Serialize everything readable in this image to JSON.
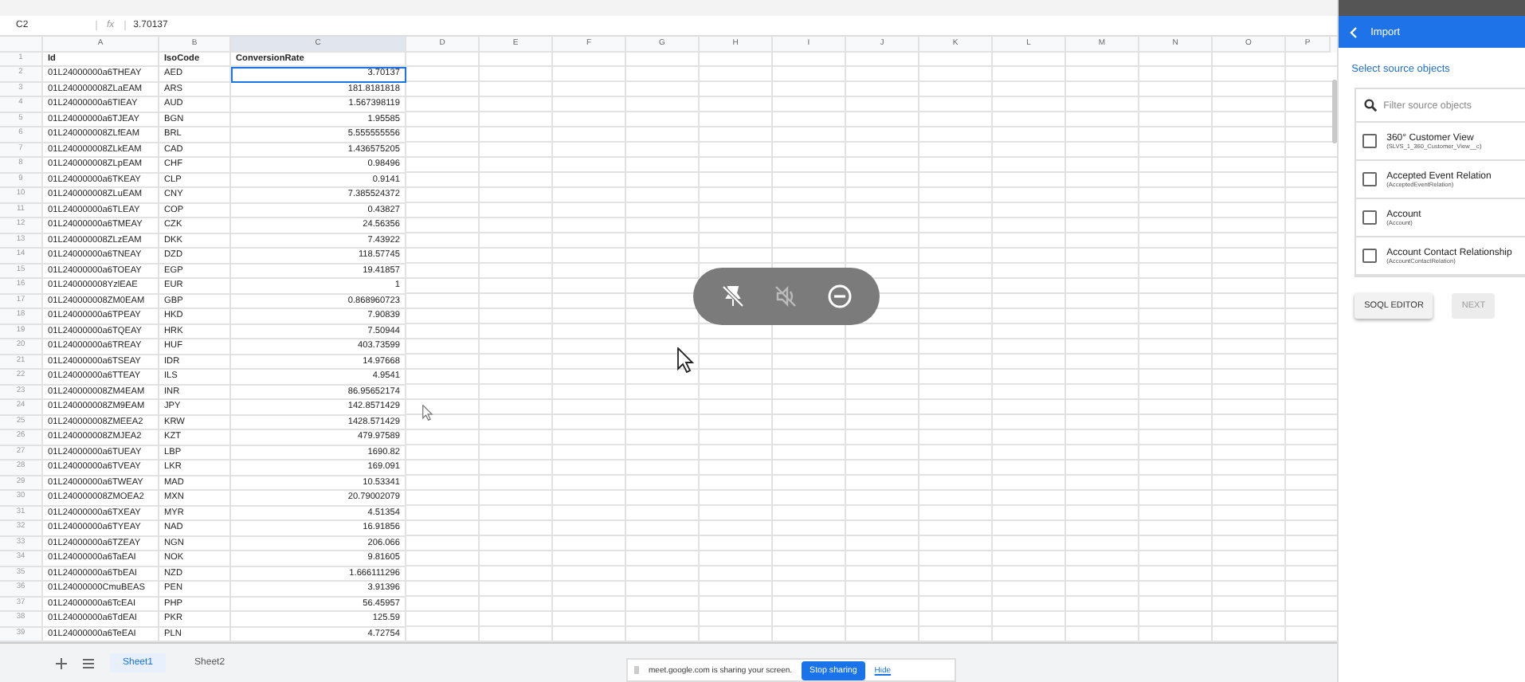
{
  "formula_bar": {
    "cell_ref": "C2",
    "fx": "fx",
    "value": "3.70137"
  },
  "columns": [
    "A",
    "B",
    "C",
    "D",
    "E",
    "F",
    "G",
    "H",
    "I",
    "J",
    "K",
    "L",
    "M",
    "N",
    "O",
    "P"
  ],
  "header_row": {
    "number": "1",
    "cells": [
      "Id",
      "IsoCode",
      "ConversionRate"
    ]
  },
  "rows": [
    {
      "number": "2",
      "id": "01L24000000a6THEAY",
      "iso": "AED",
      "rate": "3.70137",
      "selected": true
    },
    {
      "number": "3",
      "id": "01L240000008ZLaEAM",
      "iso": "ARS",
      "rate": "181.8181818",
      "selected": false
    },
    {
      "number": "4",
      "id": "01L24000000a6TIEAY",
      "iso": "AUD",
      "rate": "1.567398119",
      "selected": false
    },
    {
      "number": "5",
      "id": "01L24000000a6TJEAY",
      "iso": "BGN",
      "rate": "1.95585",
      "selected": false
    },
    {
      "number": "6",
      "id": "01L240000008ZLfEAM",
      "iso": "BRL",
      "rate": "5.555555556",
      "selected": false
    },
    {
      "number": "7",
      "id": "01L240000008ZLkEAM",
      "iso": "CAD",
      "rate": "1.436575205",
      "selected": false
    },
    {
      "number": "8",
      "id": "01L240000008ZLpEAM",
      "iso": "CHF",
      "rate": "0.98496",
      "selected": false
    },
    {
      "number": "9",
      "id": "01L24000000a6TKEAY",
      "iso": "CLP",
      "rate": "0.9141",
      "selected": false
    },
    {
      "number": "10",
      "id": "01L240000008ZLuEAM",
      "iso": "CNY",
      "rate": "7.385524372",
      "selected": false
    },
    {
      "number": "11",
      "id": "01L24000000a6TLEAY",
      "iso": "COP",
      "rate": "0.43827",
      "selected": false
    },
    {
      "number": "12",
      "id": "01L24000000a6TMEAY",
      "iso": "CZK",
      "rate": "24.56356",
      "selected": false
    },
    {
      "number": "13",
      "id": "01L240000008ZLzEAM",
      "iso": "DKK",
      "rate": "7.43922",
      "selected": false
    },
    {
      "number": "14",
      "id": "01L24000000a6TNEAY",
      "iso": "DZD",
      "rate": "118.57745",
      "selected": false
    },
    {
      "number": "15",
      "id": "01L24000000a6TOEAY",
      "iso": "EGP",
      "rate": "19.41857",
      "selected": false
    },
    {
      "number": "16",
      "id": "01L240000008YzlEAE",
      "iso": "EUR",
      "rate": "1",
      "selected": false
    },
    {
      "number": "17",
      "id": "01L240000008ZM0EAM",
      "iso": "GBP",
      "rate": "0.868960723",
      "selected": false
    },
    {
      "number": "18",
      "id": "01L24000000a6TPEAY",
      "iso": "HKD",
      "rate": "7.90839",
      "selected": false
    },
    {
      "number": "19",
      "id": "01L24000000a6TQEAY",
      "iso": "HRK",
      "rate": "7.50944",
      "selected": false
    },
    {
      "number": "20",
      "id": "01L24000000a6TREAY",
      "iso": "HUF",
      "rate": "403.73599",
      "selected": false
    },
    {
      "number": "21",
      "id": "01L24000000a6TSEAY",
      "iso": "IDR",
      "rate": "14.97668",
      "selected": false
    },
    {
      "number": "22",
      "id": "01L24000000a6TTEAY",
      "iso": "ILS",
      "rate": "4.9541",
      "selected": false
    },
    {
      "number": "23",
      "id": "01L240000008ZM4EAM",
      "iso": "INR",
      "rate": "86.95652174",
      "selected": false
    },
    {
      "number": "24",
      "id": "01L240000008ZM9EAM",
      "iso": "JPY",
      "rate": "142.8571429",
      "selected": false
    },
    {
      "number": "25",
      "id": "01L240000008ZMEEA2",
      "iso": "KRW",
      "rate": "1428.571429",
      "selected": false
    },
    {
      "number": "26",
      "id": "01L240000008ZMJEA2",
      "iso": "KZT",
      "rate": "479.97589",
      "selected": false
    },
    {
      "number": "27",
      "id": "01L24000000a6TUEAY",
      "iso": "LBP",
      "rate": "1690.82",
      "selected": false
    },
    {
      "number": "28",
      "id": "01L24000000a6TVEAY",
      "iso": "LKR",
      "rate": "169.091",
      "selected": false
    },
    {
      "number": "29",
      "id": "01L24000000a6TWEAY",
      "iso": "MAD",
      "rate": "10.53341",
      "selected": false
    },
    {
      "number": "30",
      "id": "01L240000008ZMOEA2",
      "iso": "MXN",
      "rate": "20.79002079",
      "selected": false
    },
    {
      "number": "31",
      "id": "01L24000000a6TXEAY",
      "iso": "MYR",
      "rate": "4.51354",
      "selected": false
    },
    {
      "number": "32",
      "id": "01L24000000a6TYEAY",
      "iso": "NAD",
      "rate": "16.91856",
      "selected": false
    },
    {
      "number": "33",
      "id": "01L24000000a6TZEAY",
      "iso": "NGN",
      "rate": "206.066",
      "selected": false
    },
    {
      "number": "34",
      "id": "01L24000000a6TaEAI",
      "iso": "NOK",
      "rate": "9.81605",
      "selected": false
    },
    {
      "number": "35",
      "id": "01L24000000a6TbEAI",
      "iso": "NZD",
      "rate": "1.666111296",
      "selected": false
    },
    {
      "number": "36",
      "id": "01L24000000CmuBEAS",
      "iso": "PEN",
      "rate": "3.91396",
      "selected": false
    },
    {
      "number": "37",
      "id": "01L24000000a6TcEAI",
      "iso": "PHP",
      "rate": "56.45957",
      "selected": false
    },
    {
      "number": "38",
      "id": "01L24000000a6TdEAI",
      "iso": "PKR",
      "rate": "125.59",
      "selected": false
    },
    {
      "number": "39",
      "id": "01L24000000a6TeEAI",
      "iso": "PLN",
      "rate": "4.72754",
      "selected": false
    }
  ],
  "sheet_tabs": [
    {
      "label": "Sheet1",
      "selected": true
    },
    {
      "label": "Sheet2",
      "selected": false
    }
  ],
  "import_panel": {
    "title": "Import",
    "subtitle": "Select source objects",
    "search": {
      "placeholder": "Filter source objects"
    },
    "items": [
      {
        "label": "360° Customer View",
        "api_name": "(SLVS_1_360_Customer_View__c)",
        "checked": false
      },
      {
        "label": "Accepted Event Relation",
        "api_name": "(AcceptedEventRelation)",
        "checked": false
      },
      {
        "label": "Account",
        "api_name": "(Account)",
        "checked": false
      },
      {
        "label": "Account Contact Relationship",
        "api_name": "(AccountContactRelation)",
        "checked": false
      }
    ],
    "buttons": [
      {
        "label": "SOQL EDITOR",
        "disabled": false
      },
      {
        "label": "NEXT",
        "disabled": true
      }
    ]
  },
  "share_bar": {
    "message": "meet.google.com is sharing your screen.",
    "stop": "Stop sharing",
    "hide": "Hide"
  }
}
